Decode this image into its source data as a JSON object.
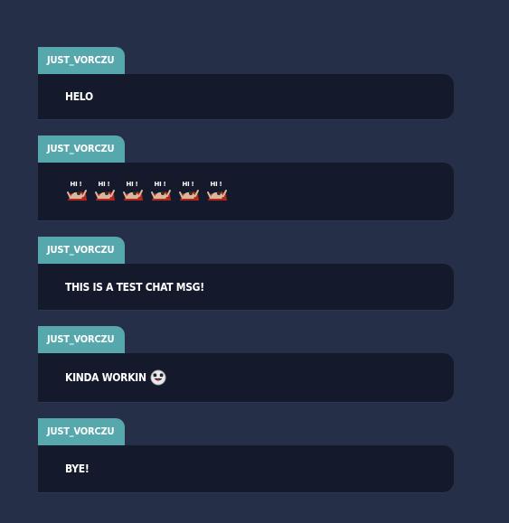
{
  "messages": [
    {
      "user": "JUST_VORCZU",
      "text": "HELO"
    },
    {
      "user": "JUST_VORCZU",
      "text": "",
      "emote_text": "HI !",
      "emote_count": 6,
      "emote_icon": "hi-emote-icon"
    },
    {
      "user": "JUST_VORCZU",
      "text": "THIS IS A TEST CHAT MSG!"
    },
    {
      "user": "JUST_VORCZU",
      "text": "KINDA WORKIN",
      "emote_icon": "tongue-face-emoji-icon"
    },
    {
      "user": "JUST_VORCZU",
      "text": "BYE!"
    }
  ],
  "colors": {
    "background": "#253048",
    "username_tag": "#56a8ad",
    "bubble": "#141a2b",
    "text": "#ffffff"
  }
}
